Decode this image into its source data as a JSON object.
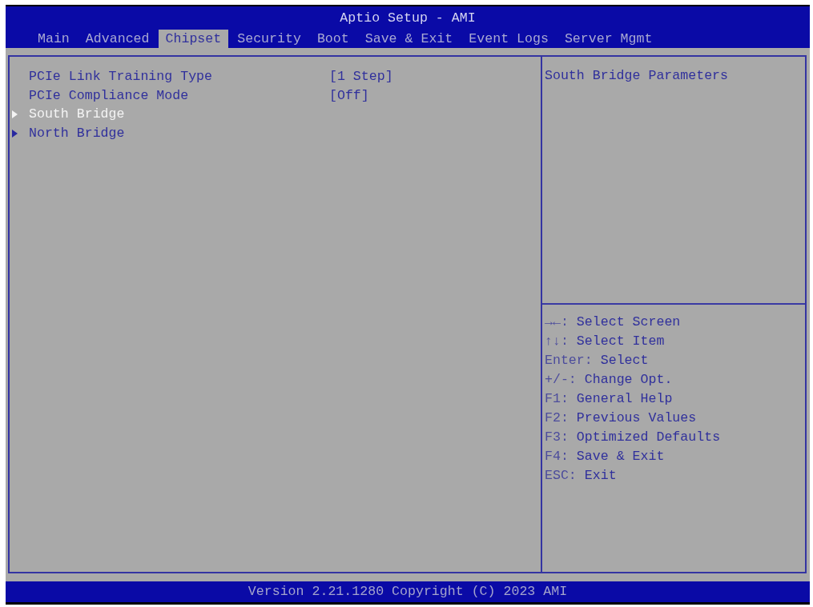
{
  "window": {
    "title": "Aptio Setup - AMI"
  },
  "tabs": [
    {
      "label": "Main",
      "selected": false
    },
    {
      "label": "Advanced",
      "selected": false
    },
    {
      "label": "Chipset",
      "selected": true
    },
    {
      "label": "Security",
      "selected": false
    },
    {
      "label": "Boot",
      "selected": false
    },
    {
      "label": "Save & Exit",
      "selected": false
    },
    {
      "label": "Event Logs",
      "selected": false
    },
    {
      "label": "Server Mgmt",
      "selected": false
    }
  ],
  "menu_items": [
    {
      "kind": "setting",
      "label": "PCIe Link Training Type",
      "value": "[1 Step]",
      "selected": false
    },
    {
      "kind": "setting",
      "label": "PCIe Compliance Mode",
      "value": "[Off]",
      "selected": false
    },
    {
      "kind": "submenu",
      "label": "South Bridge",
      "selected": true
    },
    {
      "kind": "submenu",
      "label": "North Bridge",
      "selected": false
    }
  ],
  "help_panel": {
    "description": "South Bridge Parameters",
    "key_hints": [
      {
        "key": "→←:",
        "action": "Select Screen"
      },
      {
        "key": "↑↓:",
        "action": "Select Item"
      },
      {
        "key": "Enter:",
        "action": "Select"
      },
      {
        "key": "+/-:",
        "action": "Change Opt."
      },
      {
        "key": "F1:",
        "action": "General Help"
      },
      {
        "key": "F2:",
        "action": "Previous Values"
      },
      {
        "key": "F3:",
        "action": "Optimized Defaults"
      },
      {
        "key": "F4:",
        "action": "Save & Exit"
      },
      {
        "key": "ESC:",
        "action": "Exit"
      }
    ]
  },
  "status_bar": {
    "text": "Version 2.21.1280 Copyright (C) 2023 AMI"
  }
}
